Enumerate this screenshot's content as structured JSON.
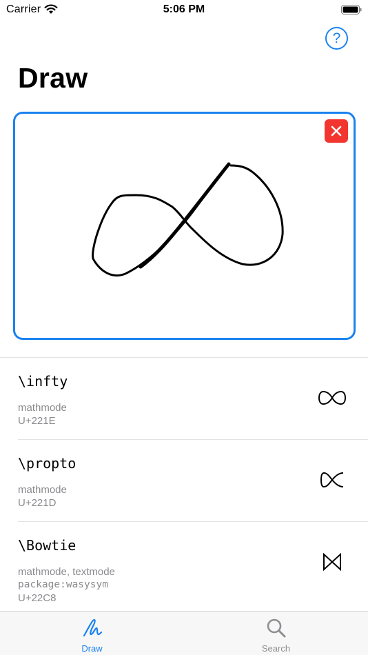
{
  "status_bar": {
    "carrier": "Carrier",
    "time": "5:06 PM"
  },
  "header": {
    "help_icon_glyph": "?",
    "title": "Draw"
  },
  "canvas": {
    "clear_icon": "close-icon",
    "accent_color": "#1a82f0",
    "clear_color": "#f2362f"
  },
  "results": [
    {
      "command": "\\infty",
      "modes": "mathmode",
      "package": "",
      "unicode": "U+221E",
      "symbol": "infinity"
    },
    {
      "command": "\\propto",
      "modes": "mathmode",
      "package": "",
      "unicode": "U+221D",
      "symbol": "proportional-to"
    },
    {
      "command": "\\Bowtie",
      "modes": "mathmode, textmode",
      "package": "package:wasysym",
      "unicode": "U+22C8",
      "symbol": "bowtie"
    }
  ],
  "tab_bar": {
    "tabs": [
      {
        "label": "Draw",
        "active": true
      },
      {
        "label": "Search",
        "active": false
      }
    ]
  }
}
